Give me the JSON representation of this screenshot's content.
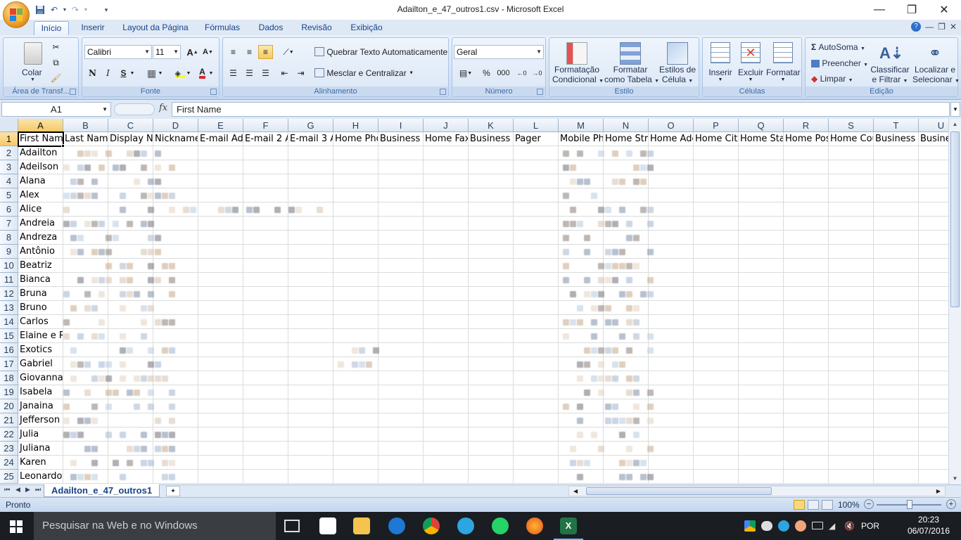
{
  "app": {
    "title": "Adailton_e_47_outros1.csv - Microsoft Excel"
  },
  "qat": {
    "save_icon": "save-icon",
    "undo_icon": "undo-icon",
    "redo_icon": "redo-icon",
    "customize_icon": "chevron-down-icon"
  },
  "window": {
    "minimize": "—",
    "restore": "❐",
    "close": "✕"
  },
  "tabs": [
    "Início",
    "Inserir",
    "Layout da Página",
    "Fórmulas",
    "Dados",
    "Revisão",
    "Exibição"
  ],
  "ribbon": {
    "clipboard": {
      "label": "Área de Transf...",
      "paste": "Colar"
    },
    "font": {
      "label": "Fonte",
      "name": "Calibri",
      "size": "11",
      "grow": "A",
      "shrink": "A",
      "bold": "N",
      "italic": "I",
      "underline": "S",
      "fontcolor": "A"
    },
    "alignment": {
      "label": "Alinhamento",
      "wrap": "Quebrar Texto Automaticamente",
      "merge": "Mesclar e Centralizar"
    },
    "number": {
      "label": "Número",
      "format": "Geral",
      "percent": "%",
      "thousands": "000"
    },
    "styles": {
      "label": "Estilo",
      "cond_line1": "Formatação",
      "cond_line2": "Condicional",
      "table_line1": "Formatar",
      "table_line2": "como Tabela",
      "cell_line1": "Estilos de",
      "cell_line2": "Célula"
    },
    "cells": {
      "label": "Células",
      "insert": "Inserir",
      "delete": "Excluir",
      "format": "Formatar"
    },
    "editing": {
      "label": "Edição",
      "autosum": "AutoSoma",
      "fill": "Preencher",
      "clear": "Limpar",
      "sort_line1": "Classificar",
      "sort_line2": "e Filtrar",
      "find_line1": "Localizar e",
      "find_line2": "Selecionar"
    }
  },
  "formula_bar": {
    "cell_ref": "A1",
    "fx": "fx",
    "value": "First Name"
  },
  "columns": [
    "A",
    "B",
    "C",
    "D",
    "E",
    "F",
    "G",
    "H",
    "I",
    "J",
    "K",
    "L",
    "M",
    "N",
    "O",
    "P",
    "Q",
    "R",
    "S",
    "T",
    "U"
  ],
  "header_row": [
    "First Name",
    "Last Name",
    "Display Na",
    "Nickname",
    "E-mail Ad",
    "E-mail 2 A",
    "E-mail 3 A",
    "Home Pho",
    "Business F",
    "Home Fax",
    "Business F",
    "Pager",
    "Mobile Ph",
    "Home Stre",
    "Home Adc",
    "Home City",
    "Home Stat",
    "Home Pos",
    "Home Cou",
    "Business A",
    "Busine"
  ],
  "rows": [
    "1",
    "2",
    "3",
    "4",
    "5",
    "6",
    "7",
    "8",
    "9",
    "10",
    "11",
    "12",
    "13",
    "14",
    "15",
    "16",
    "17",
    "18",
    "19",
    "20",
    "21",
    "22",
    "23",
    "24",
    "25"
  ],
  "first_names": [
    "Adailton",
    "Adeilson",
    "Alana",
    "Alex",
    "Alice",
    "Andreia",
    "Andreza",
    "Antônio",
    "Beatriz",
    "Bianca",
    "Bruna",
    "Bruno",
    "Carlos",
    "Elaine e Ro",
    "Exotics",
    "Gabriel",
    "Giovanna",
    "Isabela",
    "Janaina",
    "Jefferson",
    "Julia",
    "Juliana",
    "Karen",
    "Leonardo"
  ],
  "sheet": {
    "name": "Adailton_e_47_outros1"
  },
  "status": {
    "ready": "Pronto",
    "zoom": "100%"
  },
  "taskbar": {
    "search_placeholder": "Pesquisar na Web e no Windows",
    "time": "20:23",
    "date": "06/07/2016",
    "lang": "POR"
  }
}
